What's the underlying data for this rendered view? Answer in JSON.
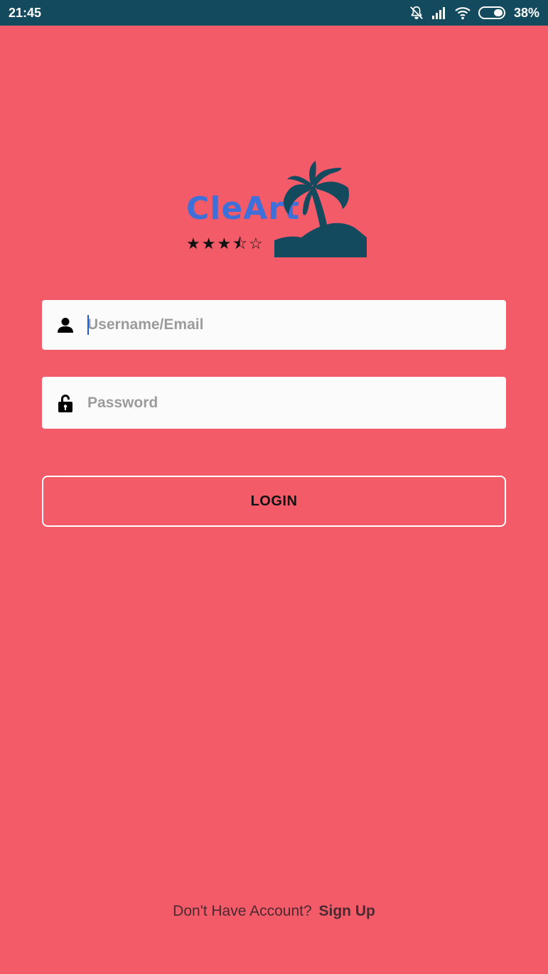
{
  "status_bar": {
    "time": "21:45",
    "battery_percent": "38%",
    "icons": [
      "notifications-off-icon",
      "signal-icon",
      "wifi-icon",
      "battery-icon"
    ]
  },
  "logo": {
    "text": "CleArt",
    "text_color": "#3f6fd8",
    "stars": "★★★⯪☆",
    "rating": 3.5,
    "art": "palm-tree-island-icon",
    "art_color": "#134a5e"
  },
  "form": {
    "username": {
      "placeholder": "Username/Email",
      "value": "",
      "icon": "user-icon"
    },
    "password": {
      "placeholder": "Password",
      "value": "",
      "icon": "lock-icon"
    },
    "login_label": "LOGIN"
  },
  "footer": {
    "prompt": "Don't Have Account?",
    "signup_label": "Sign Up"
  },
  "colors": {
    "background": "#f35b69",
    "status_bar": "#134a5e",
    "field_background": "#fbfbfb"
  }
}
